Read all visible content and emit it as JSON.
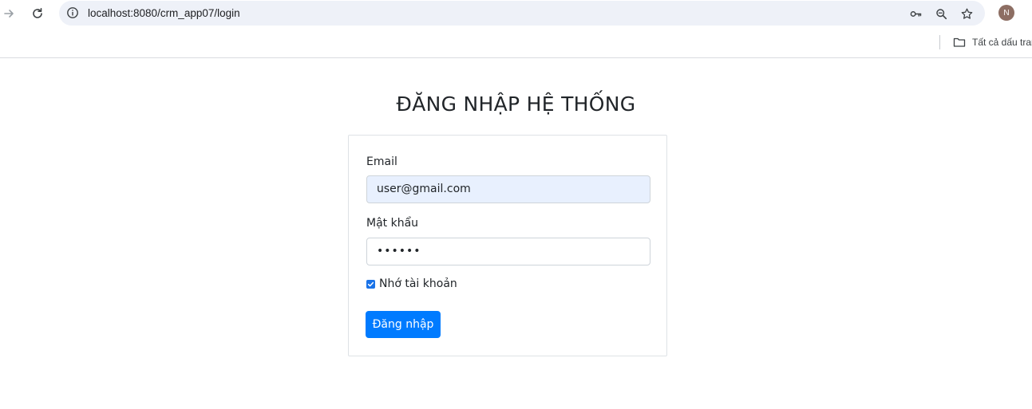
{
  "browser": {
    "url": "localhost:8080/crm_app07/login",
    "profile_initial": "N",
    "bookmarks_folder_label": "Tất cả dấu tran",
    "icons": {
      "back": "arrow-right-icon",
      "reload": "reload-icon",
      "site_info": "info-icon",
      "password": "key-icon",
      "zoom": "zoom-icon",
      "bookmark": "star-icon",
      "folder": "folder-icon"
    }
  },
  "login": {
    "title": "ĐĂNG NHẬP HỆ THỐNG",
    "email_label": "Email",
    "email_value": "user@gmail.com",
    "password_label": "Mật khẩu",
    "password_value": "••••••",
    "remember_label": "Nhớ tài khoản",
    "remember_checked": true,
    "submit_label": "Đăng nhập",
    "accent_color": "#007bff",
    "autofill_color": "#e8f0fe"
  }
}
